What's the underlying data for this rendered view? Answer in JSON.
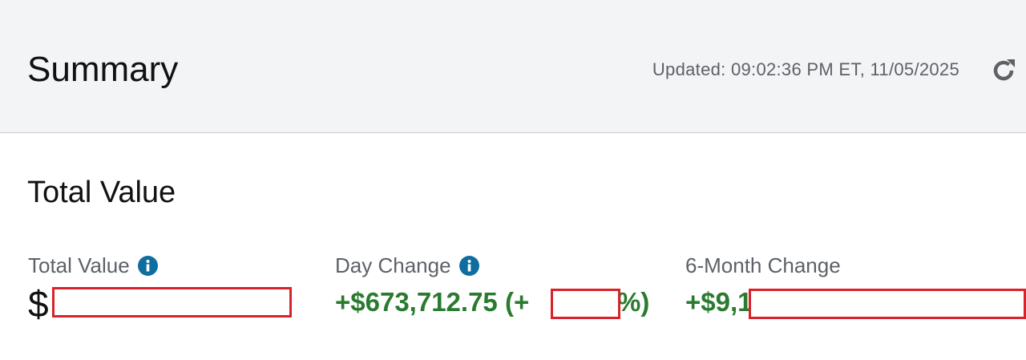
{
  "header": {
    "title": "Summary",
    "updated_text": "Updated: 09:02:36 PM ET, 11/05/2025",
    "refresh_icon": "refresh-icon"
  },
  "section": {
    "title": "Total Value"
  },
  "metrics": [
    {
      "label": "Total Value",
      "value": "$",
      "has_info": true
    },
    {
      "label": "Day Change",
      "value": "+$673,712.75 (+",
      "value_suffix": "%)",
      "has_info": true
    },
    {
      "label": "6-Month Change",
      "value": "+$9,1",
      "has_info": false
    }
  ],
  "colors": {
    "header_bg": "#f3f4f6",
    "positive": "#2a7b2f",
    "info_icon": "#0e6e9f",
    "redaction": "#d9232a"
  }
}
